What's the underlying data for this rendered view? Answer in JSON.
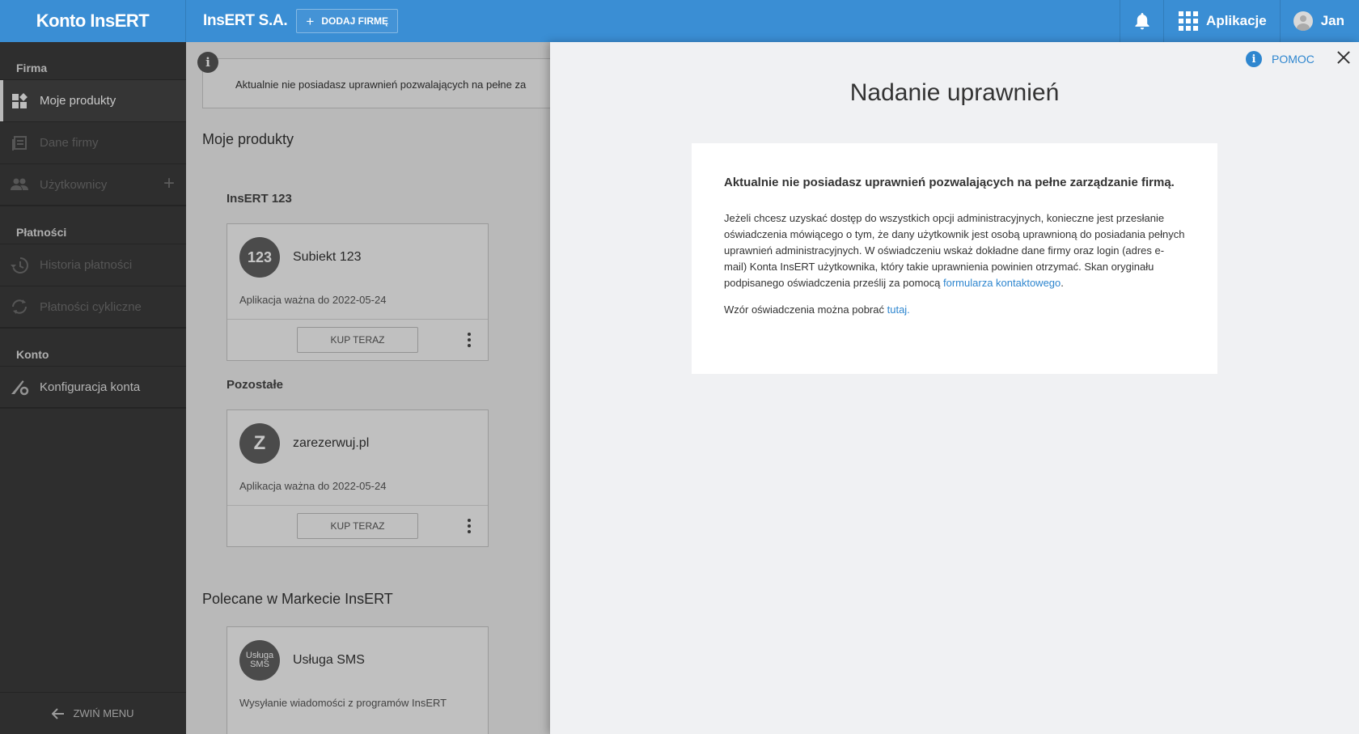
{
  "topbar": {
    "logo": "Konto InsERT",
    "company": "InsERT S.A.",
    "add_company": "DODAJ FIRMĘ",
    "apps": "Aplikacje",
    "user": "Jan"
  },
  "sidebar": {
    "section_firma": "Firma",
    "item_products": "Moje produkty",
    "item_company_data": "Dane firmy",
    "item_users": "Użytkownicy",
    "section_payments": "Płatności",
    "item_payment_history": "Historia płatności",
    "item_recurring": "Płatności cykliczne",
    "section_account": "Konto",
    "item_account_config": "Konfiguracja konta",
    "collapse": "ZWIŃ MENU"
  },
  "main": {
    "alert": "Aktualnie nie posiadasz uprawnień pozwalających na pełne za",
    "my_products": "Moje produkty",
    "group1": "InsERT 123",
    "product1": {
      "badge": "123",
      "name": "Subiekt 123",
      "valid_label": "Aplikacja ważna do",
      "valid_date": "2022-05-24",
      "buy": "KUP TERAZ"
    },
    "group2": "Pozostałe",
    "product2": {
      "badge": "Z",
      "name": "zarezerwuj.pl",
      "valid_label": "Aplikacja ważna do",
      "valid_date": "2022-05-24",
      "buy": "KUP TERAZ"
    },
    "recommended": "Polecane w Markecie InsERT",
    "product3": {
      "badge_line1": "Usługa",
      "badge_line2": "SMS",
      "name": "Usługa SMS",
      "desc": "Wysyłanie wiadomości z programów InsERT"
    }
  },
  "panel": {
    "help": "POMOC",
    "title": "Nadanie uprawnień",
    "heading": "Aktualnie nie posiadasz uprawnień pozwalających na pełne zarządzanie firmą.",
    "body": "Jeżeli chcesz uzyskać dostęp do wszystkich opcji administracyjnych, konieczne jest przesłanie oświadczenia mówiącego o tym, że dany użytkownik jest osobą uprawnioną do posiadania pełnych uprawnień administracyjnych. W oświadczeniu wskaż dokładne dane firmy oraz login (adres e-mail) Konta InsERT użytkownika, który takie uprawnienia powinien otrzymać. Skan oryginału podpisanego oświadczenia prześlij za pomocą",
    "body_link": "formularza kontaktowego",
    "body_end": ".",
    "footer": "Wzór oświadczenia można pobrać",
    "footer_link": "tutaj."
  }
}
